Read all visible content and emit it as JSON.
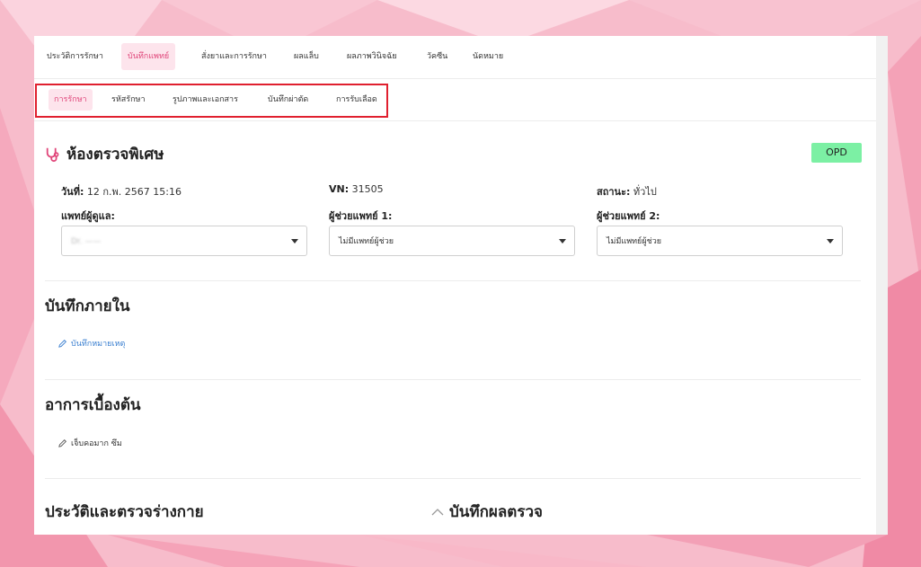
{
  "colors": {
    "accent": "#e0467a",
    "active_tab_bg": "#fde4ec",
    "highlight_border": "#e0202f",
    "opd_badge": "#7cf0a4",
    "link": "#3a7fd0"
  },
  "main_tabs": [
    {
      "label": "ประวัติการรักษา",
      "active": false
    },
    {
      "label": "บันทึกแพทย์",
      "active": true
    },
    {
      "label": "สั่งยาและการรักษา",
      "active": false
    },
    {
      "label": "ผลแล็บ",
      "active": false
    },
    {
      "label": "ผลภาพวินิจฉัย",
      "active": false
    },
    {
      "label": "วัคซีน",
      "active": false
    },
    {
      "label": "นัดหมาย",
      "active": false
    }
  ],
  "sub_tabs": [
    {
      "label": "การรักษา",
      "active": true
    },
    {
      "label": "รหัสรักษา",
      "active": false
    },
    {
      "label": "รูปภาพและเอกสาร",
      "active": false
    },
    {
      "label": "บันทึกผ่าตัด",
      "active": false
    },
    {
      "label": "การรับเลือด",
      "active": false
    }
  ],
  "room": {
    "icon": "stethoscope-icon",
    "title": "ห้องตรวจพิเศษ",
    "badge": "OPD"
  },
  "visit": {
    "date_label": "วันที่:",
    "date_value": "12 ก.พ. 2567 15:16",
    "vn_label": "VN:",
    "vn_value": "31505",
    "status_label": "สถานะ:",
    "status_value": "ทั่วไป"
  },
  "doctor": {
    "label": "แพทย์ผู้ดูแล:",
    "value": "Dr. ——"
  },
  "assistant1": {
    "label": "ผู้ช่วยแพทย์ 1:",
    "value": "ไม่มีแพทย์ผู้ช่วย"
  },
  "assistant2": {
    "label": "ผู้ช่วยแพทย์ 2:",
    "value": "ไม่มีแพทย์ผู้ช่วย"
  },
  "internal_note": {
    "title": "บันทึกภายใน",
    "icon": "pencil-icon",
    "link_label": "บันทึกหมายเหตุ"
  },
  "chief_complaint": {
    "title": "อาการเบื้องต้น",
    "icon": "pencil-icon",
    "value": "เจ็บคอมาก ซึม"
  },
  "history": {
    "title": "ประวัติและตรวจร่างกาย"
  },
  "exam_result": {
    "icon": "chevron-up-icon",
    "title": "บันทึกผลตรวจ"
  }
}
